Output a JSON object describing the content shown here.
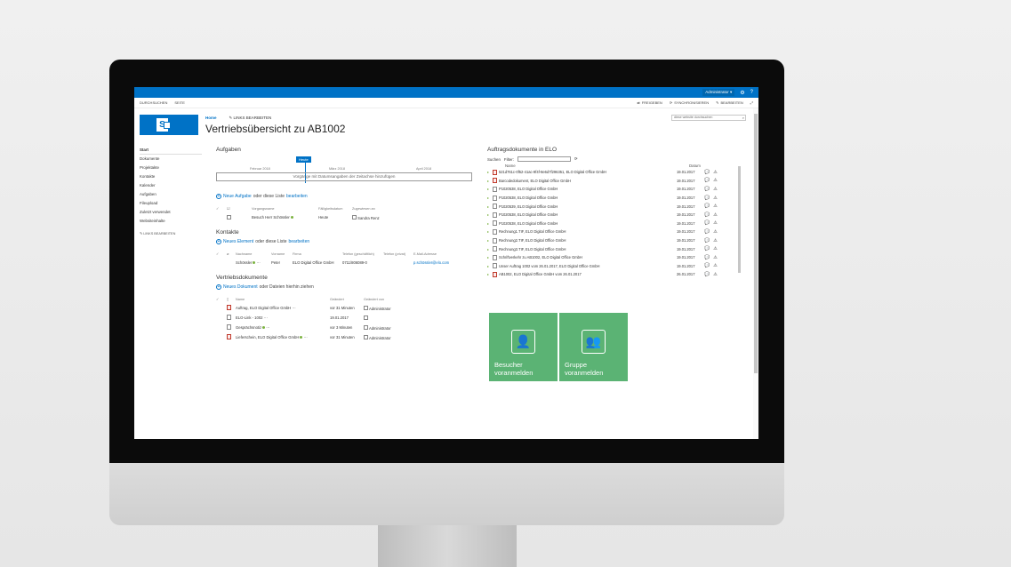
{
  "suitebar": {
    "user": "Administrator ▾"
  },
  "ribbon": {
    "tabs": [
      "DURCHSUCHEN",
      "SEITE"
    ],
    "actions": [
      "FREIGEBEN",
      "SYNCHRONISIEREN",
      "BEARBEITEN"
    ]
  },
  "header": {
    "home": "Home",
    "edit_links": "LINKS BEARBEITEN",
    "title": "Vertriebsübersicht zu AB1002",
    "search_placeholder": "diese website durchsuchen"
  },
  "leftnav": {
    "items": [
      "Start",
      "Dokumente",
      "Projektakte",
      "Kontakte",
      "Kalender",
      "Aufgaben",
      "Fileupload",
      "Zuletzt verwendet",
      "Websiteinhalte"
    ],
    "edit": "LINKS BEARBEITEN"
  },
  "aufgaben": {
    "title": "Aufgaben",
    "today": "Heute",
    "months": [
      "Februar 2018",
      "März 2018",
      "April 2018"
    ],
    "timeline_hint": "Vorgänge mit Datumsangaben der Zeitachse hinzufügen",
    "add_new": "Neue Aufgabe",
    "add_mid": " oder diese Liste ",
    "add_edit": "bearbeiten",
    "headers": [
      "Vorgangsname",
      "Fälligkeitsdatum",
      "Zugewiesen an"
    ],
    "rows": [
      {
        "name": "Besuch Herr Schössler",
        "due": "Heute",
        "assigned": "Sandra Renz"
      }
    ]
  },
  "kontakte": {
    "title": "Kontakte",
    "add_new": "Neues Element",
    "add_mid": " oder diese Liste ",
    "add_edit": "bearbeiten",
    "headers": [
      "Nachname",
      "Vorname",
      "Firma",
      "Telefon (geschäftlich)",
      "Telefon (privat)",
      "E-Mail-Adresse"
    ],
    "rows": [
      {
        "last": "Schössler",
        "first": "Peter",
        "company": "ELO Digital Office GmbH",
        "phone": "0711/806089-0",
        "private": "",
        "email": "p.schössler@elo.com"
      }
    ]
  },
  "vertrieb": {
    "title": "Vertriebsdokumente",
    "add_new": "Neues Dokument",
    "add_rest": " oder Dateien hierhin ziehen",
    "headers": [
      "Name",
      "Geändert",
      "Geändert von"
    ],
    "rows": [
      {
        "name": "Auftrag, ELO Digital Office GmbH",
        "changed": "vor 31 Minuten",
        "by": "Administrator"
      },
      {
        "name": "ELO-Link - 1002",
        "changed": "19.01.2017",
        "by": ""
      },
      {
        "name": "Gesprächsnotiz",
        "changed": "vor 3 Minuten",
        "by": "Administrator"
      },
      {
        "name": "Lieferschein, ELO Digital Office GmbH",
        "changed": "vor 31 Minuten",
        "by": "Administrator"
      }
    ]
  },
  "elo": {
    "title": "Auftragsdokumente in ELO",
    "search_label": "Suchen",
    "filter_label": "Filter:",
    "col_name": "Name",
    "col_date": "Datum",
    "rows": [
      {
        "name": "521d761c-0f52-41ac-9f4f-8e6d7f296351, ELO Digital Office GmbH",
        "date": "19.01.2017"
      },
      {
        "name": "Barcodedokument, ELO Digital Office GmbH",
        "date": "19.01.2017"
      },
      {
        "name": "P1020538, ELO Digital Office GmbH",
        "date": "19.01.2017"
      },
      {
        "name": "P1020538, ELO Digital Office GmbH",
        "date": "19.01.2017"
      },
      {
        "name": "P1020539, ELO Digital Office GmbH",
        "date": "19.01.2017"
      },
      {
        "name": "P1020538, ELO Digital Office GmbH",
        "date": "19.01.2017"
      },
      {
        "name": "P1020538, ELO Digital Office GmbH",
        "date": "19.01.2017"
      },
      {
        "name": "Rechnung1.TIF, ELO Digital Office GmbH",
        "date": "19.01.2017"
      },
      {
        "name": "Rechnung2.TIF, ELO Digital Office GmbH",
        "date": "19.01.2017"
      },
      {
        "name": "Rechnung3.TIF, ELO Digital Office GmbH",
        "date": "19.01.2017"
      },
      {
        "name": "Schriftverkehr zu AB1002, ELO Digital Office GmbH",
        "date": "19.01.2017"
      },
      {
        "name": "Unser Auftrag 1002 vom 26.01.2017, ELO Digital Office GmbH",
        "date": "19.01.2017"
      },
      {
        "name": "AB1002, ELO Digital Office GmbH vom 26.01.2017",
        "date": "26.01.2017"
      }
    ]
  },
  "tiles": [
    {
      "label": "Besucher voranmelden"
    },
    {
      "label": "Gruppe voranmelden"
    }
  ]
}
